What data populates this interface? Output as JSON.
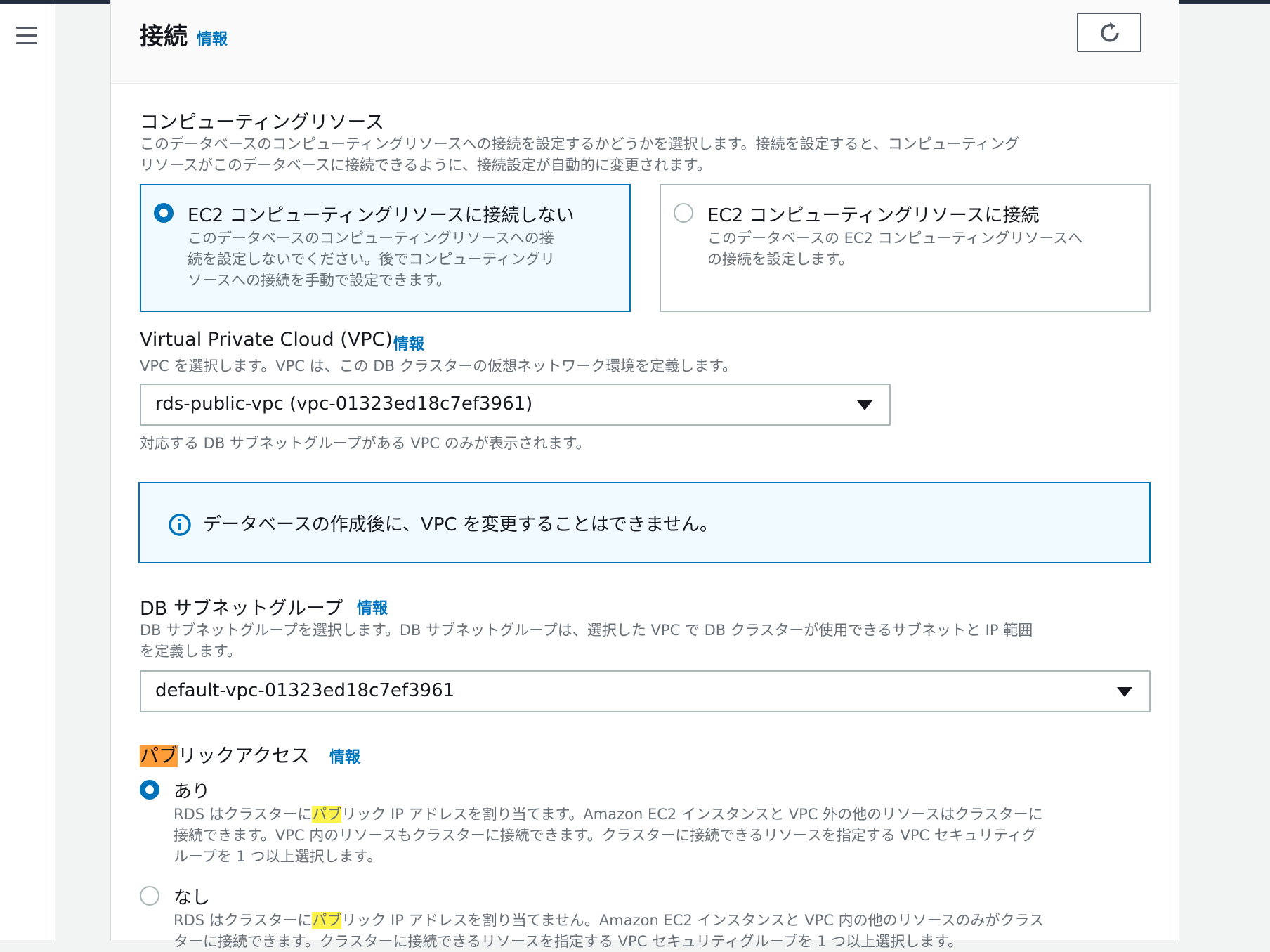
{
  "header": {
    "title": "接続",
    "info": "情報"
  },
  "compute": {
    "label": "コンピューティングリソース",
    "desc_line1": "このデータベースのコンピューティングリソースへの接続を設定するかどうかを選択します。接続を設定すると、コンピューティング",
    "desc_line2": "リソースがこのデータベースに接続できるように、接続設定が自動的に変更されます。",
    "options": [
      {
        "title": "EC2 コンピューティングリソースに接続しない",
        "desc_lines": [
          "このデータベースのコンピューティングリソースへの接",
          "続を設定しないでください。後でコンピューティングリ",
          "ソースへの接続を手動で設定できます。"
        ],
        "selected": true
      },
      {
        "title": "EC2 コンピューティングリソースに接続",
        "desc_lines": [
          "このデータベースの EC2 コンピューティングリソースへ",
          "の接続を設定します。"
        ],
        "selected": false
      }
    ]
  },
  "vpc": {
    "label": "Virtual Private Cloud (VPC)",
    "info": "情報",
    "desc": "VPC を選択します。VPC は、この DB クラスターの仮想ネットワーク環境を定義します。",
    "value": "rds-public-vpc (vpc-01323ed18c7ef3961)",
    "hint": "対応する DB サブネットグループがある VPC のみが表示されます。"
  },
  "alert": {
    "text": "データベースの作成後に、VPC を変更することはできません。"
  },
  "subnet": {
    "label": "DB サブネットグループ",
    "info": "情報",
    "desc_line1": "DB サブネットグループを選択します。DB サブネットグループは、選択した VPC で DB クラスターが使用できるサブネットと IP 範囲",
    "desc_line2": "を定義します。",
    "value": "default-vpc-01323ed18c7ef3961"
  },
  "public_access": {
    "label_highlight": "パブ",
    "label_rest": "リックアクセス",
    "info": "情報",
    "yes": {
      "label": "あり",
      "line1_pre": "RDS はクラスターに",
      "line1_hl": "パブ",
      "line1_post": "リック IP アドレスを割り当てます。Amazon EC2 インスタンスと VPC 外の他のリソースはクラスターに",
      "line2": "接続できます。VPC 内のリソースもクラスターに接続できます。クラスターに接続できるリソースを指定する VPC セキュリティグ",
      "line3": "ループを 1 つ以上選択します。"
    },
    "no": {
      "label": "なし",
      "line1_pre": "RDS はクラスターに",
      "line1_hl": "パブ",
      "line1_post": "リック IP アドレスを割り当てません。Amazon EC2 インスタンスと VPC 内の他のリソースのみがクラス",
      "line2": "ターに接続できます。クラスターに接続できるリソースを指定する VPC セキュリティグループを 1 つ以上選択します。"
    }
  },
  "colors": {
    "accent": "#0073bb",
    "highlight_orange": "#ff9d3a",
    "highlight_yellow": "#fff34a"
  }
}
